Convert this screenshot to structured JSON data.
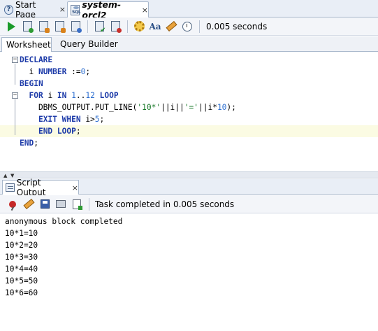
{
  "doc_tabs": {
    "start_page": "Start Page",
    "connection": "system-orcl2",
    "close_glyph": "×"
  },
  "toolbar": {
    "elapsed": "0.005 seconds",
    "icons": [
      "run-statement-icon",
      "run-script-icon",
      "autotrace-icon",
      "explain-plan-icon",
      "sql-tuning-icon",
      "commit-icon",
      "rollback-icon",
      "unshared-sql-icon",
      "to-upper-lower-icon",
      "clear-icon",
      "sql-history-icon"
    ]
  },
  "sub_tabs": {
    "worksheet": "Worksheet",
    "query_builder": "Query Builder"
  },
  "editor": {
    "lines": [
      [
        {
          "t": "DECLARE",
          "c": "kw"
        }
      ],
      [
        {
          "t": "  i ",
          "c": "plain"
        },
        {
          "t": "NUMBER",
          "c": "kw"
        },
        {
          "t": " :=",
          "c": "plain"
        },
        {
          "t": "0",
          "c": "num"
        },
        {
          "t": ";",
          "c": "plain"
        }
      ],
      [
        {
          "t": "BEGIN",
          "c": "kw"
        }
      ],
      [
        {
          "t": "  ",
          "c": "plain"
        },
        {
          "t": "FOR",
          "c": "kw"
        },
        {
          "t": " i ",
          "c": "plain"
        },
        {
          "t": "IN",
          "c": "kw"
        },
        {
          "t": " ",
          "c": "plain"
        },
        {
          "t": "1",
          "c": "num"
        },
        {
          "t": "..",
          "c": "plain"
        },
        {
          "t": "12",
          "c": "num"
        },
        {
          "t": " ",
          "c": "plain"
        },
        {
          "t": "LOOP",
          "c": "kw"
        }
      ],
      [
        {
          "t": "    DBMS_OUTPUT.PUT_LINE(",
          "c": "plain"
        },
        {
          "t": "'10*'",
          "c": "str"
        },
        {
          "t": "||i||",
          "c": "plain"
        },
        {
          "t": "'='",
          "c": "str"
        },
        {
          "t": "||i*",
          "c": "plain"
        },
        {
          "t": "10",
          "c": "num"
        },
        {
          "t": ");",
          "c": "plain"
        }
      ],
      [
        {
          "t": "    ",
          "c": "plain"
        },
        {
          "t": "EXIT WHEN",
          "c": "kw"
        },
        {
          "t": " i>",
          "c": "plain"
        },
        {
          "t": "5",
          "c": "num"
        },
        {
          "t": ";",
          "c": "plain"
        }
      ],
      [
        {
          "t": "    ",
          "c": "plain"
        },
        {
          "t": "END LOOP",
          "c": "kw"
        },
        {
          "t": ";",
          "c": "plain"
        }
      ],
      [
        {
          "t": "END",
          "c": "kw"
        },
        {
          "t": ";",
          "c": "plain"
        }
      ]
    ],
    "highlighted_line": 6
  },
  "output_panel": {
    "tab_label": "Script Output",
    "close_glyph": "×",
    "task_status": "Task completed in 0.005 seconds",
    "lines": [
      "anonymous block completed",
      "10*1=10",
      "10*2=20",
      "10*3=30",
      "10*4=40",
      "10*5=50",
      "10*6=60"
    ]
  }
}
